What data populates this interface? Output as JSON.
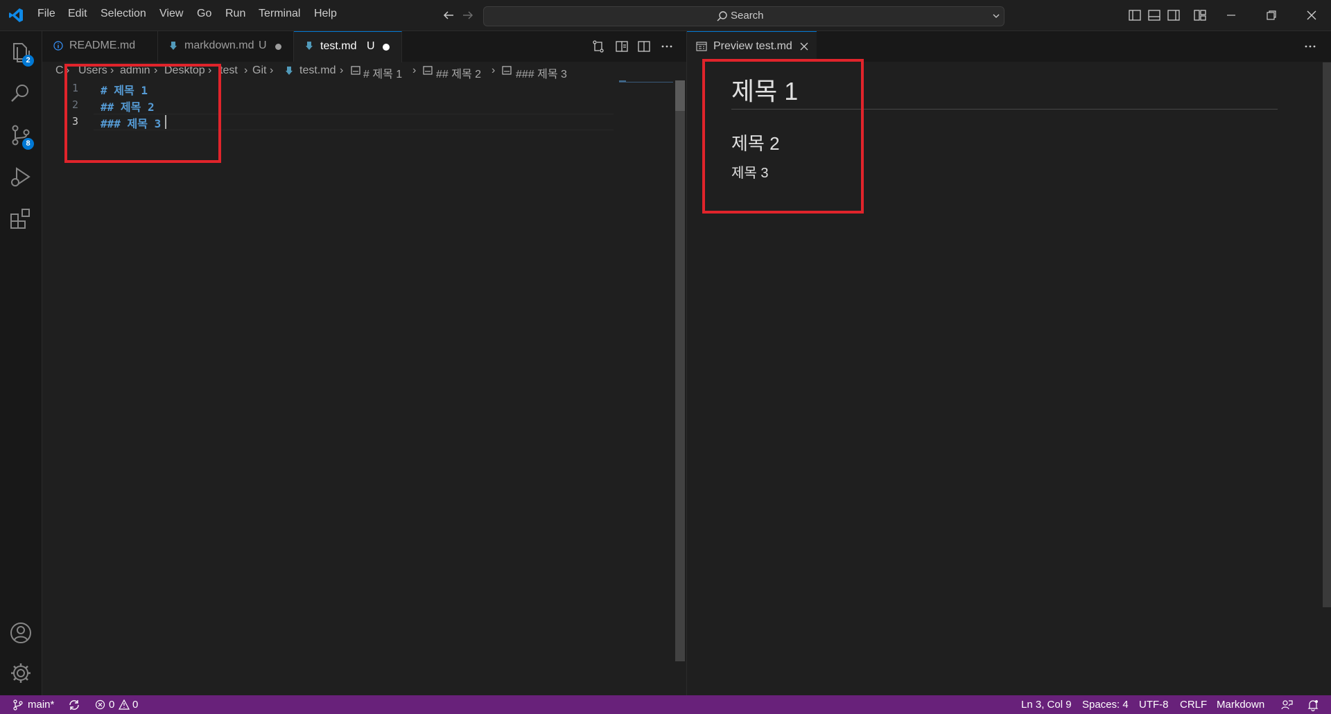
{
  "menu": [
    "File",
    "Edit",
    "Selection",
    "View",
    "Go",
    "Run",
    "Terminal",
    "Help"
  ],
  "search": {
    "label": "Search"
  },
  "activity": {
    "explorer_badge": "2",
    "scm_badge": "8"
  },
  "tabs": [
    {
      "label": "README.md",
      "status": ""
    },
    {
      "label": "markdown.md",
      "status": "U"
    },
    {
      "label": "test.md",
      "status": "U"
    }
  ],
  "breadcrumb": {
    "drive": "C:",
    "parts": [
      "Users",
      "admin",
      "Desktop",
      "test",
      "Git"
    ],
    "file": "test.md",
    "symbols": [
      "# 제목 1",
      "## 제목 2",
      "### 제목 3"
    ]
  },
  "editor": {
    "lines": [
      {
        "num": "1",
        "text": "# 제목 1"
      },
      {
        "num": "2",
        "text": "## 제목 2"
      },
      {
        "num": "3",
        "text": "### 제목 3"
      }
    ]
  },
  "preview": {
    "tab_label": "Preview test.md",
    "h1": "제목 1",
    "h2": "제목 2",
    "h3": "제목 3"
  },
  "status": {
    "branch": "main*",
    "errors": "0",
    "warnings": "0",
    "position": "Ln 3, Col 9",
    "spaces": "Spaces: 4",
    "encoding": "UTF-8",
    "eol": "CRLF",
    "language": "Markdown"
  },
  "colors": {
    "accent": "#0078d4",
    "statusbar": "#68217a",
    "highlight": "#e0242b",
    "heading": "#569cd6"
  }
}
